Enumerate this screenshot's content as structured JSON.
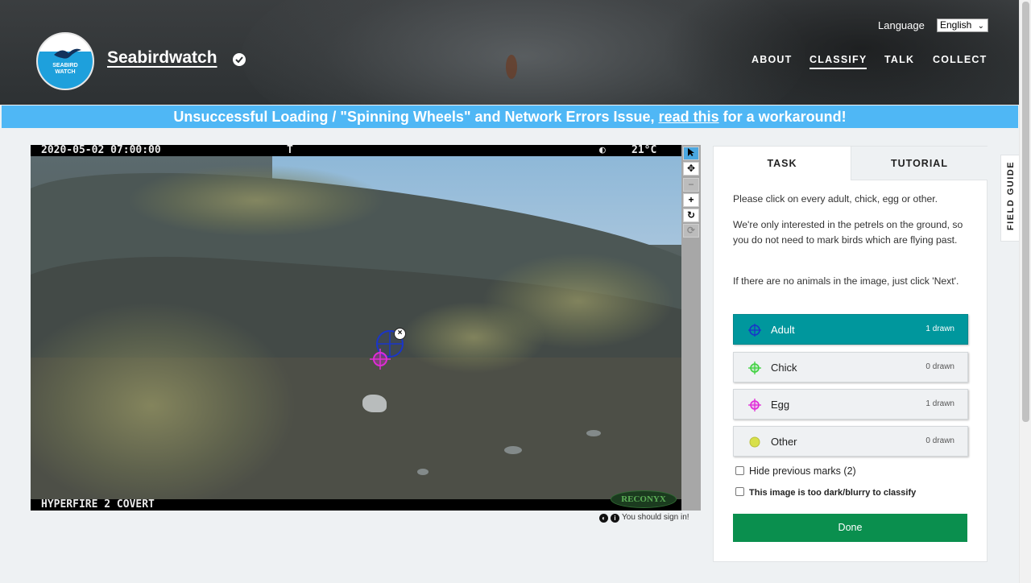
{
  "site": {
    "title": "Seabirdwatch",
    "logo_text_line1": "SEABIRD",
    "logo_text_line2": "WATCH"
  },
  "language": {
    "label": "Language",
    "selected": "English"
  },
  "nav": {
    "about": "ABOUT",
    "classify": "CLASSIFY",
    "talk": "TALK",
    "collect": "COLLECT"
  },
  "banner": {
    "prefix": "Unsuccessful Loading / \"Spinning Wheels\" and Network Errors Issue, ",
    "link": "read this",
    "suffix": " for a workaround!"
  },
  "camera": {
    "datetime": "2020-05-02 07:00:00",
    "flag": "T",
    "moon": "◐",
    "temperature": "21°C",
    "model": "HYPERFIRE 2 COVERT",
    "brand": "RECONYX"
  },
  "viewer": {
    "signin_text": "You should sign in!"
  },
  "task_panel": {
    "tabs": {
      "task": "TASK",
      "tutorial": "TUTORIAL"
    },
    "instructions": [
      "Please click on every adult, chick, egg or other.",
      "We're only interested in the petrels on the ground, so you do not need to mark birds which are flying past.",
      "If there are no animals in the image, just click 'Next'."
    ],
    "tools": [
      {
        "label": "Adult",
        "count": "1 drawn",
        "color": "#1a35c9",
        "selected": true
      },
      {
        "label": "Chick",
        "count": "0 drawn",
        "color": "#3fd23f",
        "selected": false
      },
      {
        "label": "Egg",
        "count": "1 drawn",
        "color": "#e02bd8",
        "selected": false
      },
      {
        "label": "Other",
        "count": "0 drawn",
        "color": "#d8e04a",
        "selected": false
      }
    ],
    "hide_marks": "Hide previous marks (2)",
    "too_dark": "This image is too dark/blurry to classify",
    "done": "Done"
  },
  "field_guide": "FIELD GUIDE"
}
